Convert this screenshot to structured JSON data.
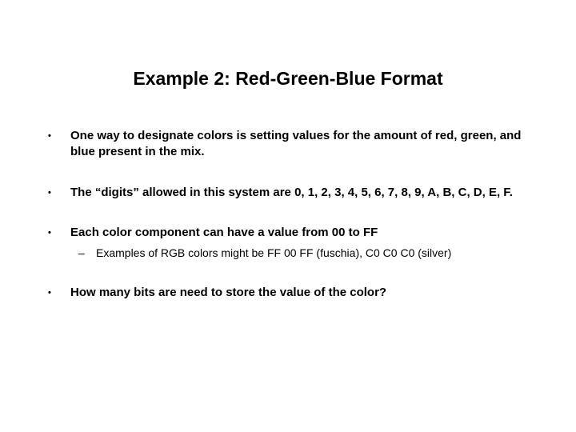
{
  "title": "Example 2: Red-Green-Blue Format",
  "bullets": [
    {
      "text": "One way to designate colors is setting values for the amount of red, green, and blue present in the mix."
    },
    {
      "text": "The “digits” allowed in this system are 0, 1, 2, 3, 4, 5, 6, 7, 8, 9, A, B, C, D, E, F."
    },
    {
      "text": "Each color component can have a value from 00 to FF",
      "sub": [
        "Examples of RGB colors might be FF 00 FF (fuschia), C0 C0 C0 (silver)"
      ]
    },
    {
      "text": "How many bits are need to store the value of the color?"
    }
  ],
  "markers": {
    "bullet": "•",
    "sub": "–"
  }
}
